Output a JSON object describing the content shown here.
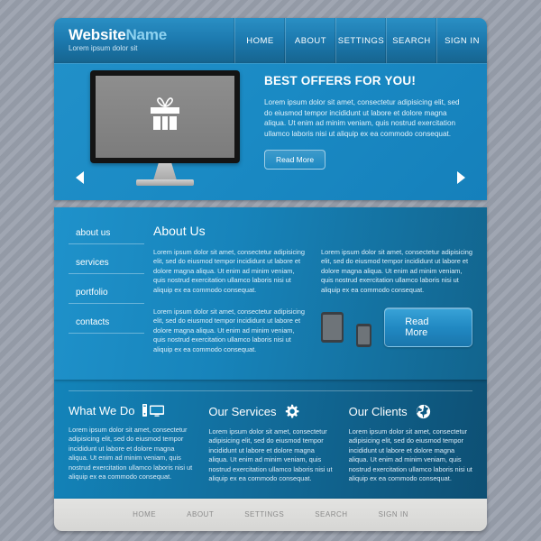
{
  "header": {
    "logo_main": "Website",
    "logo_accent": "Name",
    "tagline": "Lorem ipsum dolor sit",
    "nav": [
      {
        "label": "HOME"
      },
      {
        "label": "ABOUT"
      },
      {
        "label": "SETTINGS"
      },
      {
        "label": "SEARCH"
      },
      {
        "label": "SIGN IN"
      }
    ]
  },
  "hero": {
    "title": "BEST OFFERS FOR YOU!",
    "body": "Lorem ipsum dolor sit amet, consectetur adipisicing elit, sed do eiusmod tempor incididunt ut labore et dolore magna aliqua. Ut enim ad minim veniam, quis nostrud exercitation ullamco laboris nisi ut aliquip ex ea commodo consequat.",
    "button_label": "Read More",
    "monitor_icon": "gift-box-icon",
    "prev_icon": "arrow-left-icon",
    "next_icon": "arrow-right-icon"
  },
  "about": {
    "title": "About Us",
    "menu": [
      {
        "label": "about us"
      },
      {
        "label": "services"
      },
      {
        "label": "portfolio"
      },
      {
        "label": "contacts"
      }
    ],
    "col_left": [
      "Lorem ipsum dolor sit amet, consectetur adipisicing elit, sed do eiusmod tempor incididunt ut labore et dolore magna aliqua. Ut enim ad minim veniam, quis nostrud exercitation ullamco laboris nisi ut aliquip ex ea commodo consequat.",
      "Lorem ipsum dolor sit amet, consectetur adipisicing elit, sed do eiusmod tempor incididunt ut labore et dolore magna aliqua. Ut enim ad minim veniam, quis nostrud exercitation ullamco laboris nisi ut aliquip ex ea commodo consequat."
    ],
    "col_right": "Lorem ipsum dolor sit amet, consectetur adipisicing elit, sed do eiusmod tempor incididunt ut labore et dolore magna aliqua. Ut enim ad minim veniam, quis nostrud exercitation ullamco laboris nisi ut aliquip ex ea commodo consequat.",
    "button_label": "Read More",
    "device_icons": [
      "tablet-icon",
      "phone-icon"
    ]
  },
  "features": [
    {
      "title": "What We Do",
      "icon": "desktop-computer-icon",
      "body": "Lorem ipsum dolor sit amet, consectetur adipisicing elit, sed do eiusmod tempor incididunt ut labore et dolore magna aliqua. Ut enim ad minim veniam, quis nostrud exercitation ullamco laboris nisi ut aliquip ex ea commodo consequat."
    },
    {
      "title": "Our Services",
      "icon": "gear-icon",
      "body": "Lorem ipsum dolor sit amet, consectetur adipisicing elit, sed do eiusmod tempor incididunt ut labore et dolore magna aliqua. Ut enim ad minim veniam, quis nostrud exercitation ullamco laboris nisi ut aliquip ex ea commodo consequat."
    },
    {
      "title": "Our Clients",
      "icon": "globe-icon",
      "body": "Lorem ipsum dolor sit amet, consectetur adipisicing elit, sed do eiusmod tempor incididunt ut labore et dolore magna aliqua. Ut enim ad minim veniam, quis nostrud exercitation ullamco laboris nisi ut aliquip ex ea commodo consequat."
    }
  ],
  "footer": {
    "nav": [
      {
        "label": "HOME"
      },
      {
        "label": "ABOUT"
      },
      {
        "label": "SETTINGS"
      },
      {
        "label": "SEARCH"
      },
      {
        "label": "SIGN IN"
      }
    ]
  },
  "colors": {
    "brand_blue": "#1a8ac4",
    "dark_blue": "#0d4f73",
    "accent_light": "#8ed2f0",
    "footer_gray": "#d6d6d4"
  }
}
